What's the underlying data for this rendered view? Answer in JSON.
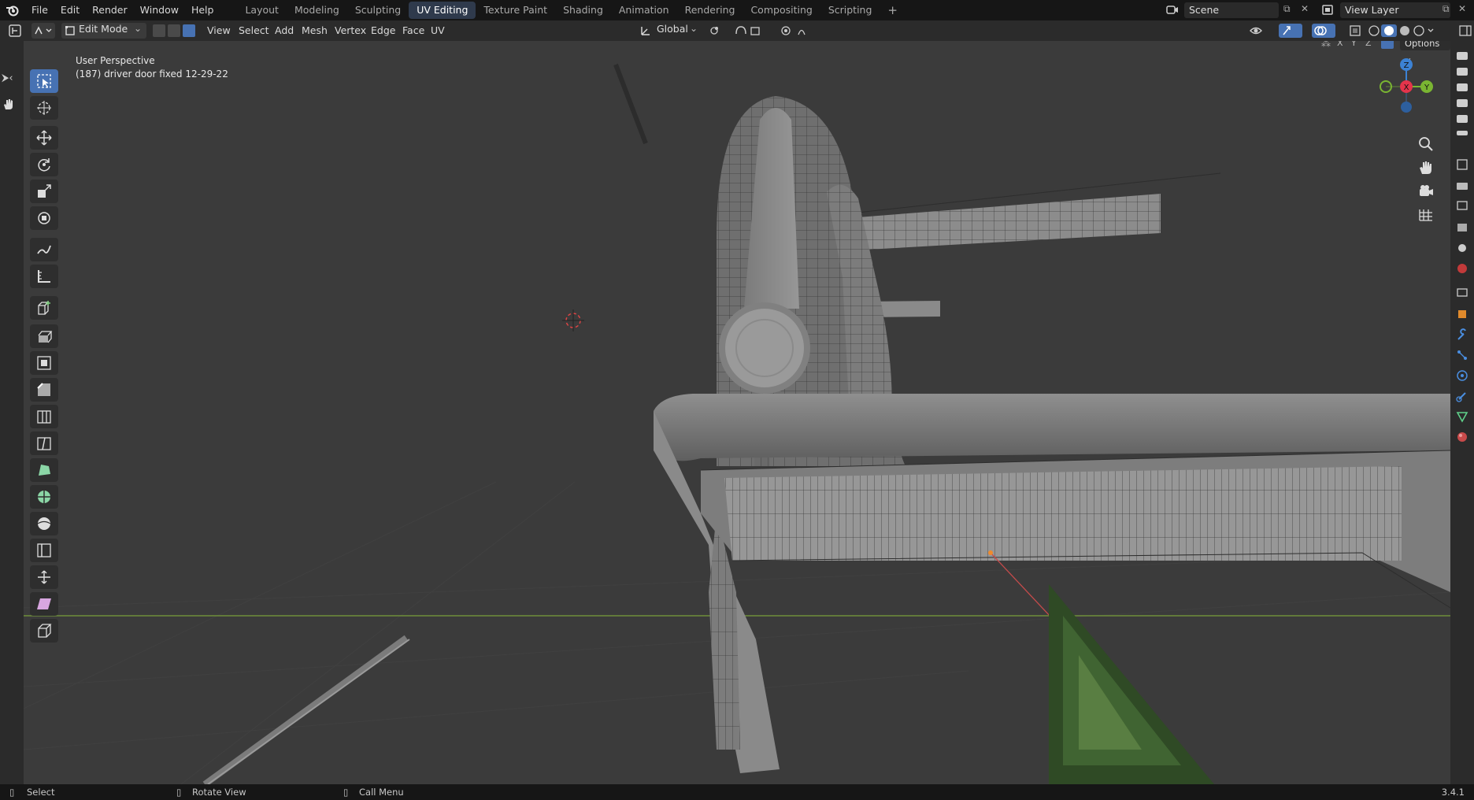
{
  "menus": [
    "File",
    "Edit",
    "Render",
    "Window",
    "Help"
  ],
  "workspaces": [
    {
      "label": "Layout",
      "active": false
    },
    {
      "label": "Modeling",
      "active": false
    },
    {
      "label": "Sculpting",
      "active": false
    },
    {
      "label": "UV Editing",
      "active": true
    },
    {
      "label": "Texture Paint",
      "active": false
    },
    {
      "label": "Shading",
      "active": false
    },
    {
      "label": "Animation",
      "active": false
    },
    {
      "label": "Rendering",
      "active": false
    },
    {
      "label": "Compositing",
      "active": false
    },
    {
      "label": "Scripting",
      "active": false
    }
  ],
  "add_workspace_label": "+",
  "scene_label": "Scene",
  "view_layer_label": "View Layer",
  "header": {
    "mode": "Edit Mode",
    "menus": [
      "View",
      "Select",
      "Add",
      "Mesh",
      "Vertex",
      "Edge",
      "Face",
      "UV"
    ],
    "orientation": "Global",
    "options_label": "Options",
    "axes": [
      "X",
      "Y",
      "Z"
    ]
  },
  "overlay": {
    "view_name": "User Perspective",
    "object_info": "(187) driver door fixed 12-29-22"
  },
  "gizmo": {
    "z": "Z",
    "x": "X",
    "y": "Y"
  },
  "status": {
    "select": "Select",
    "rotate": "Rotate View",
    "call_menu": "Call Menu",
    "version": "3.4.1"
  },
  "colors": {
    "accent": "#4772b3",
    "active_workspace": "#2f3a4c",
    "viewport_bg": "#3b3b3b",
    "axis_x": "#e4344b",
    "axis_y": "#7ab532",
    "axis_z": "#3c82d4"
  }
}
